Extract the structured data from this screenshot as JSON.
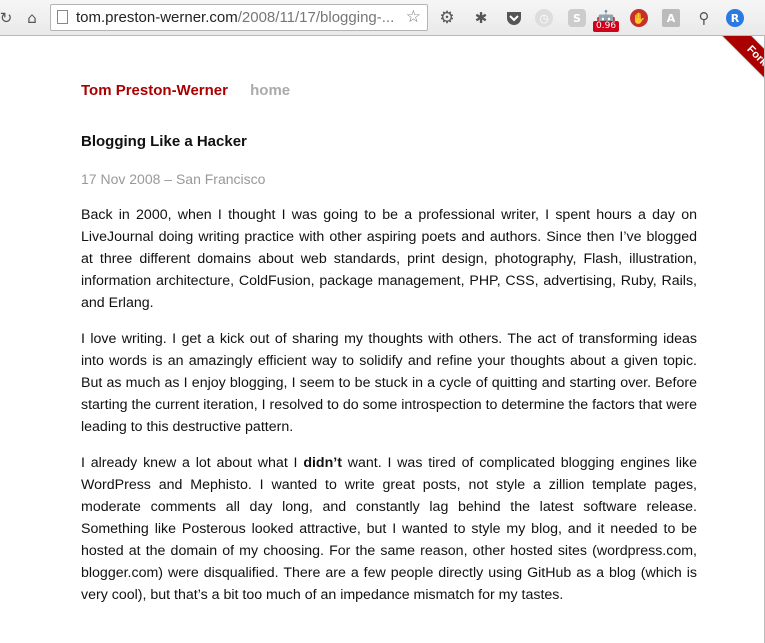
{
  "browser": {
    "url_host": "tom.preston-werner.com",
    "url_path": "/2008/11/17/blogging-...",
    "badge": "0.96"
  },
  "site": {
    "title": "Tom Preston-Werner",
    "home": "home",
    "ribbon": "Fork"
  },
  "post": {
    "title": "Blogging Like a Hacker",
    "meta": "17 Nov 2008 – San Francisco",
    "p1": "Back in 2000, when I thought I was going to be a professional writer, I spent hours a day on LiveJournal doing writing practice with other aspiring poets and authors. Since then I’ve blogged at three different domains about web standards, print design, photography, Flash, illustration, information architecture, ColdFusion, package management, PHP, CSS, advertising, Ruby, Rails, and Erlang.",
    "p2": "I love writing. I get a kick out of sharing my thoughts with others. The act of transforming ideas into words is an amazingly efficient way to solidify and refine your thoughts about a given topic. But as much as I enjoy blogging, I seem to be stuck in a cycle of quitting and starting over. Before starting the current iteration, I resolved to do some introspection to determine the factors that were leading to this destructive pattern.",
    "p3_a": "I already knew a lot about what I ",
    "p3_strong": "didn’t",
    "p3_b": " want. I was tired of complicated blogging engines like WordPress and Mephisto. I wanted to write great posts, not style a zillion template pages, moderate comments all day long, and constantly lag behind the latest software release. Something like Posterous looked attractive, but I wanted to style my blog, and it needed to be hosted at the domain of my choosing. For the same reason, other hosted sites (wordpress.com, blogger.com) were disqualified. There are a few people directly using GitHub as a blog (which is very cool), but that’s a bit too much of an impedance mismatch for my tastes."
  },
  "colors": {
    "accent": "#aa0000",
    "muted": "#999999"
  }
}
